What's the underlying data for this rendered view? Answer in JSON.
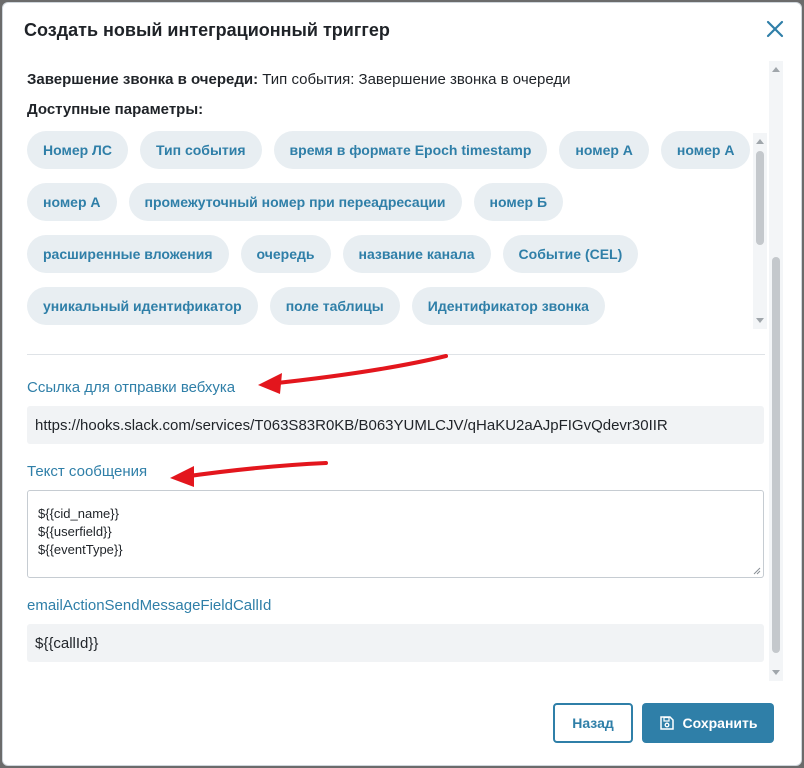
{
  "dialog": {
    "title": "Создать новый интеграционный триггер",
    "close_icon": "close-icon"
  },
  "event_info": {
    "name": "Завершение звонка в очереди:",
    "detail": "Тип события: Завершение звонка в очереди"
  },
  "params": {
    "label": "Доступные параметры:",
    "rows": [
      [
        "Номер ЛС",
        "Тип события",
        "время в формате Epoch timestamp",
        "номер А",
        "номер А"
      ],
      [
        "номер А",
        "промежуточный номер при переадресации",
        "номер Б"
      ],
      [
        "расширенные вложения",
        "очередь",
        "название канала",
        "Событие (CEL)"
      ],
      [
        "уникальный идентификатор",
        "поле таблицы",
        "Идентификатор звонка"
      ]
    ]
  },
  "webhook": {
    "label": "Ссылка для отправки вебхука",
    "value": "https://hooks.slack.com/services/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"
  },
  "message": {
    "label": "Текст сообщения",
    "lines": [
      "${{cid_name}}",
      "${{userfield}}",
      "${{eventType}}"
    ]
  },
  "callid": {
    "label": "emailActionSendMessageFieldCallId",
    "value": "${{callId}}"
  },
  "footer": {
    "back_label": "Назад",
    "save_label": "Сохранить",
    "save_icon": "save-icon"
  },
  "colors": {
    "accent": "#2f7fa8",
    "chip_bg": "#e8eef2",
    "annotation_arrow": "#e3161d"
  }
}
